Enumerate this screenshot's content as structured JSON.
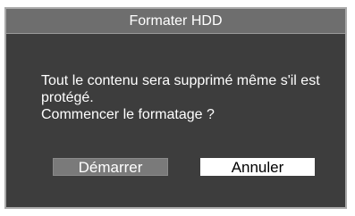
{
  "dialog": {
    "title": "Formater HDD",
    "message": {
      "line1": "Tout le contenu sera supprimé même s'il est",
      "line2": "protégé.",
      "line3": "Commencer le formatage ?"
    },
    "buttons": {
      "start_label": "Démarrer",
      "cancel_label": "Annuler"
    }
  },
  "colors": {
    "dialog_background": "#3d3d3d",
    "title_background": "#6e6e6e",
    "selected_button_background": "#ffffff",
    "unselected_button_background": "#7a7a7a"
  }
}
